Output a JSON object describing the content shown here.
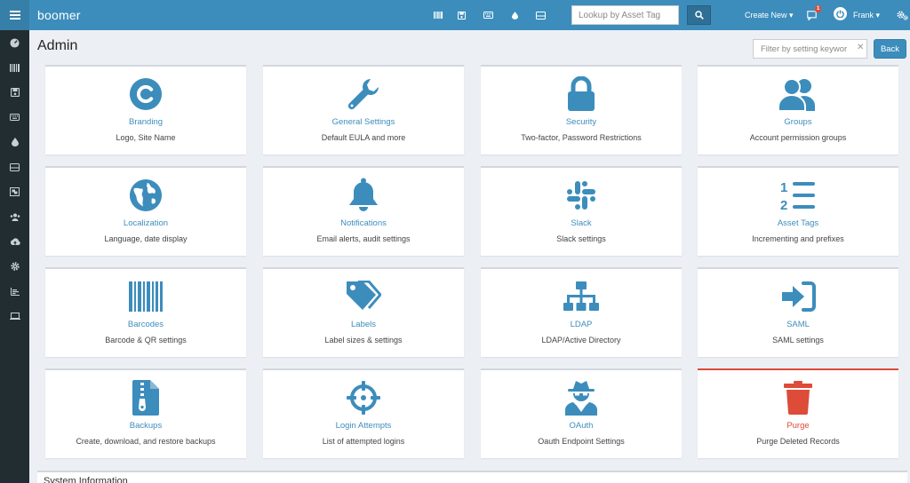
{
  "app": {
    "brand": "boomer"
  },
  "header": {
    "search_placeholder": "Lookup by Asset Tag",
    "create_new": "Create New ▾",
    "notification_count": "1",
    "user": "Frank ▾"
  },
  "page": {
    "title": "Admin",
    "filter_placeholder": "Filter by setting keyword",
    "back": "Back",
    "section_title": "System Information"
  },
  "tiles": [
    {
      "name": "Branding",
      "desc": "Logo, Site Name",
      "icon": "copyright-icon"
    },
    {
      "name": "General Settings",
      "desc": "Default EULA and more",
      "icon": "wrench-icon"
    },
    {
      "name": "Security",
      "desc": "Two-factor, Password Restrictions",
      "icon": "lock-icon"
    },
    {
      "name": "Groups",
      "desc": "Account permission groups",
      "icon": "users-icon"
    },
    {
      "name": "Localization",
      "desc": "Language, date display",
      "icon": "globe-icon"
    },
    {
      "name": "Notifications",
      "desc": "Email alerts, audit settings",
      "icon": "bell-icon"
    },
    {
      "name": "Slack",
      "desc": "Slack settings",
      "icon": "slack-icon"
    },
    {
      "name": "Asset Tags",
      "desc": "Incrementing and prefixes",
      "icon": "list-ol-icon"
    },
    {
      "name": "Barcodes",
      "desc": "Barcode & QR settings",
      "icon": "barcode-icon"
    },
    {
      "name": "Labels",
      "desc": "Label sizes & settings",
      "icon": "tags-icon"
    },
    {
      "name": "LDAP",
      "desc": "LDAP/Active Directory",
      "icon": "sitemap-icon"
    },
    {
      "name": "SAML",
      "desc": "SAML settings",
      "icon": "sign-in-icon"
    },
    {
      "name": "Backups",
      "desc": "Create, download, and restore backups",
      "icon": "file-archive-icon"
    },
    {
      "name": "Login Attempts",
      "desc": "List of attempted logins",
      "icon": "crosshairs-icon"
    },
    {
      "name": "OAuth",
      "desc": "Oauth Endpoint Settings",
      "icon": "user-secret-icon"
    },
    {
      "name": "Purge",
      "desc": "Purge Deleted Records",
      "icon": "trash-icon"
    }
  ],
  "colors": {
    "sidebar": "#222d32",
    "header": "#3c8dbc",
    "accent": "#3c8dbc",
    "danger": "#dd4b39",
    "background": "#ecf0f5"
  }
}
